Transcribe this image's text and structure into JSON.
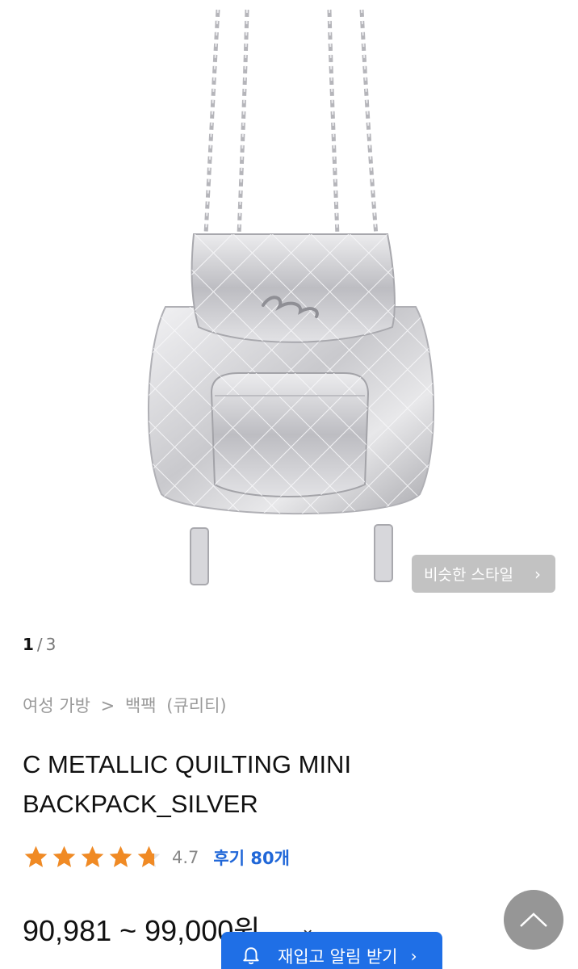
{
  "gallery": {
    "image_alt": "silver quilted mini backpack with chain straps",
    "similar_style_label": "비슷한 스타일",
    "current_page": "1",
    "page_separator": "/",
    "total_pages": "3"
  },
  "breadcrumb": {
    "category": "여성 가방",
    "separator": ">",
    "subcategory": "백팩",
    "brand": "(큐리티)"
  },
  "product": {
    "title": "C METALLIC QUILTING MINI BACKPACK_SILVER",
    "rating_value": "4.7",
    "rating_stars": 4.7,
    "reviews_label": "후기 80개",
    "price": "90,981 ~ 99,000원"
  },
  "actions": {
    "restock_alert_label": "재입고 알림 받기"
  },
  "icons": {
    "chevron": "chevron-right-icon",
    "bell": "bell-icon",
    "up": "arrow-up-icon"
  },
  "colors": {
    "star": "#f08a24",
    "link_blue": "#2067d8",
    "button_blue": "#1f6fe6"
  }
}
